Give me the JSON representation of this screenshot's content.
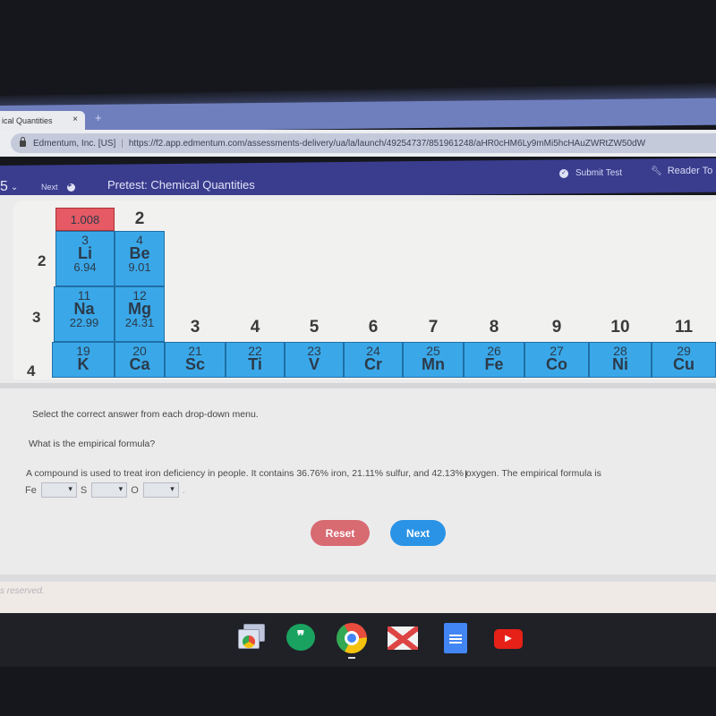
{
  "browser": {
    "tab_title": "ical Quantities",
    "tab_close": "×",
    "new_tab": "+",
    "site_identity": "Edmentum, Inc. [US]",
    "url": "https://f2.app.edmentum.com/assessments-delivery/ua/la/launch/49254737/851961248/aHR0cHM6Ly9mMi5hcHAuZWRtZW50dW"
  },
  "header": {
    "question_number": "5",
    "next_label": "Next",
    "title": "Pretest: Chemical Quantities",
    "submit_label": "Submit Test",
    "reader_label": "Reader To"
  },
  "periodic_table": {
    "h_mass": "1.008",
    "periods": [
      "2",
      "3",
      "4"
    ],
    "groups": [
      "2",
      "3",
      "4",
      "5",
      "6",
      "7",
      "8",
      "9",
      "10",
      "11"
    ],
    "row2": [
      {
        "num": "3",
        "sym": "Li",
        "mass": "6.94"
      },
      {
        "num": "4",
        "sym": "Be",
        "mass": "9.01"
      }
    ],
    "row3": [
      {
        "num": "11",
        "sym": "Na",
        "mass": "22.99"
      },
      {
        "num": "12",
        "sym": "Mg",
        "mass": "24.31"
      }
    ],
    "row4": [
      {
        "num": "19",
        "sym": "K"
      },
      {
        "num": "20",
        "sym": "Ca"
      },
      {
        "num": "21",
        "sym": "Sc"
      },
      {
        "num": "22",
        "sym": "Ti"
      },
      {
        "num": "23",
        "sym": "V"
      },
      {
        "num": "24",
        "sym": "Cr"
      },
      {
        "num": "25",
        "sym": "Mn"
      },
      {
        "num": "26",
        "sym": "Fe"
      },
      {
        "num": "27",
        "sym": "Co"
      },
      {
        "num": "28",
        "sym": "Ni"
      },
      {
        "num": "29",
        "sym": "Cu"
      }
    ]
  },
  "question": {
    "instruction": "Select the correct answer from each drop-down menu.",
    "prompt": "What is the empirical formula?",
    "stem": "A compound is used to treat iron deficiency in people. It contains 36.76% iron, 21.11% sulfur, and 42.13% oxygen. The empirical formula is",
    "formula": {
      "fe_label": "Fe",
      "s_label": "S",
      "o_label": "O",
      "fe_value": "",
      "s_value": "",
      "o_value": "",
      "end": "."
    }
  },
  "buttons": {
    "reset": "Reset",
    "next": "Next"
  },
  "footer": {
    "copyright": "s reserved."
  },
  "shelf": {
    "apps": [
      "overview",
      "hangouts",
      "chrome",
      "gmail",
      "docs",
      "youtube"
    ],
    "hangouts_glyph": "❞",
    "youtube_glyph": "▶"
  },
  "colors": {
    "nav_bg": "#3a3c8e",
    "element_blue": "#3aa8e8",
    "hydrogen_red": "#e55a64",
    "reset_red": "#d86a72",
    "next_blue": "#2a93e6"
  }
}
